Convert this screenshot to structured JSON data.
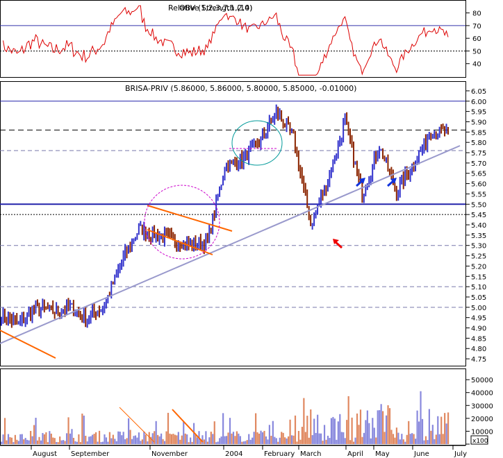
{
  "rsi_panel": {
    "title_overlap_1": "Relative Strength (14)",
    "title_overlap_2": "OBV (1,2,3,7,1,2,0)",
    "ticks": [
      "80",
      "70",
      "60",
      "50",
      "40"
    ],
    "tick_values": [
      80,
      70,
      60,
      50,
      40
    ],
    "ylim": [
      30,
      88
    ],
    "ref_lines": [
      70,
      50
    ]
  },
  "price_panel": {
    "title": "BRISA-PRIV (5.86000, 5.86000, 5.80000, 5.85000, -0.01000)",
    "ticks": [
      "6.05",
      "6.00",
      "5.95",
      "5.90",
      "5.85",
      "5.80",
      "5.75",
      "5.70",
      "5.65",
      "5.60",
      "5.55",
      "5.50",
      "5.45",
      "5.40",
      "5.35",
      "5.30",
      "5.25",
      "5.20",
      "5.15",
      "5.10",
      "5.05",
      "5.00",
      "4.95",
      "4.90",
      "4.85",
      "4.80",
      "4.75"
    ],
    "tick_values": [
      6.05,
      6.0,
      5.95,
      5.9,
      5.85,
      5.8,
      5.75,
      5.7,
      5.65,
      5.6,
      5.55,
      5.5,
      5.45,
      5.4,
      5.35,
      5.3,
      5.25,
      5.2,
      5.15,
      5.1,
      5.05,
      5.0,
      4.95,
      4.9,
      4.85,
      4.8,
      4.75
    ],
    "ylim": [
      4.72,
      6.08
    ],
    "h_solid": [
      6.0,
      5.5
    ],
    "h_dashed": [
      5.86,
      5.76,
      5.45,
      5.3,
      5.1,
      5.0
    ],
    "colors": {
      "up": "#3333cc",
      "down": "#8b2500",
      "trend": "#9999cc",
      "orange": "#ff6600",
      "magenta": "#cc00cc",
      "teal": "#009999",
      "red_arrow": "#ee0000",
      "blue_arrow": "#1133dd"
    }
  },
  "volume_panel": {
    "ticks": [
      "50000",
      "40000",
      "30000",
      "20000",
      "10000",
      "0"
    ],
    "tick_values": [
      50000,
      40000,
      30000,
      20000,
      10000,
      0
    ],
    "multiplier": "x100",
    "ylim": [
      0,
      56000
    ]
  },
  "x_axis": {
    "months": [
      "August",
      "September",
      "November",
      "2004",
      "February",
      "March",
      "April",
      "May",
      "June",
      "July"
    ]
  },
  "chart_data": {
    "type": "bar",
    "title": "BRISA-PRIV (5.86000, 5.86000, 5.80000, 5.85000, -0.01000)",
    "ylabel": "",
    "xlabel": "",
    "ylim": [
      4.72,
      6.08
    ],
    "price_anchors": {
      "x_index": [
        0,
        10,
        20,
        30,
        40,
        50,
        60,
        70,
        80,
        90,
        100,
        110,
        120,
        130,
        140,
        150,
        160,
        170,
        180,
        190,
        200,
        210,
        220,
        230,
        240,
        250,
        260
      ],
      "close": [
        4.96,
        4.92,
        5.0,
        4.98,
        5.0,
        4.95,
        5.01,
        5.22,
        5.38,
        5.35,
        5.33,
        5.3,
        5.32,
        5.68,
        5.72,
        5.8,
        5.95,
        5.82,
        5.4,
        5.62,
        5.9,
        5.55,
        5.78,
        5.56,
        5.7,
        5.85,
        5.85
      ]
    },
    "last_close": 5.85,
    "series": [
      {
        "name": "BRISA-PRIV",
        "values": [
          5.86,
          5.86,
          5.8,
          5.85,
          -0.01
        ]
      }
    ]
  }
}
